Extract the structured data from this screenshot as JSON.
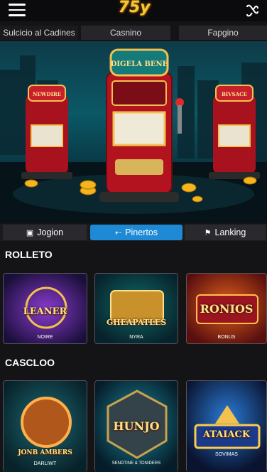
{
  "header": {
    "logo_text": "75y",
    "menu_icon": "hamburger-menu-icon",
    "swap_icon": "swap-arrows-icon"
  },
  "tabs": [
    {
      "label": "Sulcicio al Cadines"
    },
    {
      "label": "Casnino"
    },
    {
      "label": "Fapgino"
    }
  ],
  "hero": {
    "machine_center_sign": "DIGELA BENE",
    "machine_left_sign": "NEWDIRE",
    "machine_right_sign": "BIVSACE"
  },
  "segments": [
    {
      "label": "Jogion",
      "icon": "grid-icon"
    },
    {
      "label": "Pinertos",
      "icon": "arrow-icon",
      "active": true
    },
    {
      "label": "Lanking",
      "icon": "flag-icon"
    }
  ],
  "sections": [
    {
      "title": "ROLLETO",
      "cards": [
        {
          "label": "LEANER",
          "sublabel": "NOIRE"
        },
        {
          "label": "GHEAPATLES",
          "sublabel": "NYRA"
        },
        {
          "label": "RONIOS",
          "sublabel": "BONUS"
        }
      ]
    },
    {
      "title": "CASCLOO",
      "cards": [
        {
          "label": "JONB AMBERS",
          "sublabel": "DARLIWT"
        },
        {
          "label": "HUNJO",
          "sublabel": "SENDTINE & TONIDERS"
        },
        {
          "label": "ATAIACK",
          "sublabel": "SOVIMAS"
        }
      ]
    }
  ],
  "colors": {
    "accent": "#1e8ad6",
    "logo_gold": "#f6c93a",
    "background": "#141416"
  }
}
